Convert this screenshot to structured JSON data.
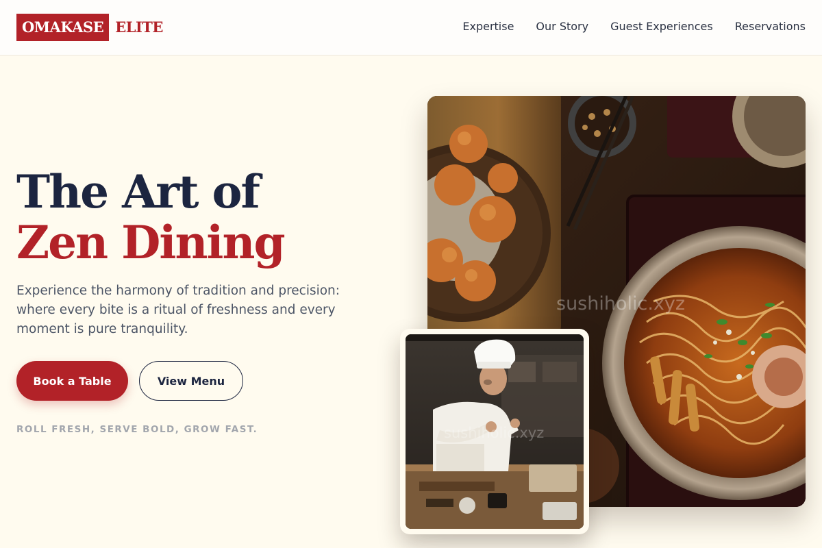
{
  "brand": {
    "logo_box_text": "OMAKASE",
    "logo_text": "ELITE",
    "accent_color": "#b22228",
    "navy_color": "#1c2540"
  },
  "nav": {
    "items": [
      {
        "label": "Expertise"
      },
      {
        "label": "Our Story"
      },
      {
        "label": "Guest Experiences"
      },
      {
        "label": "Reservations"
      }
    ]
  },
  "hero": {
    "title_line1": "The Art of",
    "title_line2": "Zen Dining",
    "subtitle": "Experience the harmony of tradition and precision: where every bite is a ritual of freshness and every moment is pure tranquility.",
    "primary_button": "Book a Table",
    "secondary_button": "View Menu",
    "tagline": "ROLL FRESH, SERVE BOLD, GROW FAST."
  },
  "images": {
    "main_watermark": "sushiholic.xyz",
    "chef_watermark": "sushiholic.xyz"
  }
}
